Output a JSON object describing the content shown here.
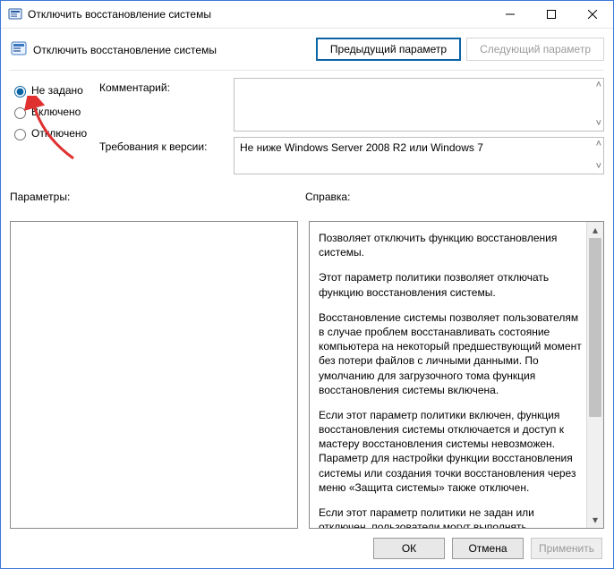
{
  "window": {
    "title": "Отключить восстановление системы"
  },
  "header": {
    "setting_name": "Отключить восстановление системы",
    "prev_label": "Предыдущий параметр",
    "next_label": "Следующий параметр"
  },
  "radios": {
    "not_configured": "Не задано",
    "enabled": "Включено",
    "disabled": "Отключено",
    "selected": "not_configured"
  },
  "fields": {
    "comment_label": "Комментарий:",
    "version_label": "Требования к версии:",
    "version_value": "Не ниже Windows Server 2008 R2 или Windows 7"
  },
  "labels": {
    "params": "Параметры:",
    "help": "Справка:"
  },
  "help_text": {
    "p1": "Позволяет отключить функцию восстановления системы.",
    "p2": "Этот параметр политики позволяет отключать функцию восстановления системы.",
    "p3": "Восстановление системы позволяет пользователям в случае проблем восстанавливать состояние компьютера на некоторый предшествующий момент без потери файлов с личными данными. По умолчанию для загрузочного тома функция восстановления системы включена.",
    "p4": "Если этот параметр политики включен, функция восстановления системы отключается и доступ к мастеру восстановления системы невозможен. Параметр для настройки функции восстановления системы или создания точки восстановления через меню «Защита системы» также отключен.",
    "p5": "Если этот параметр политики не задан или отключен, пользователи могут выполнять восстановление системы и настраивать функцию восстановления системы через меню"
  },
  "buttons": {
    "ok": "ОК",
    "cancel": "Отмена",
    "apply": "Применить"
  }
}
